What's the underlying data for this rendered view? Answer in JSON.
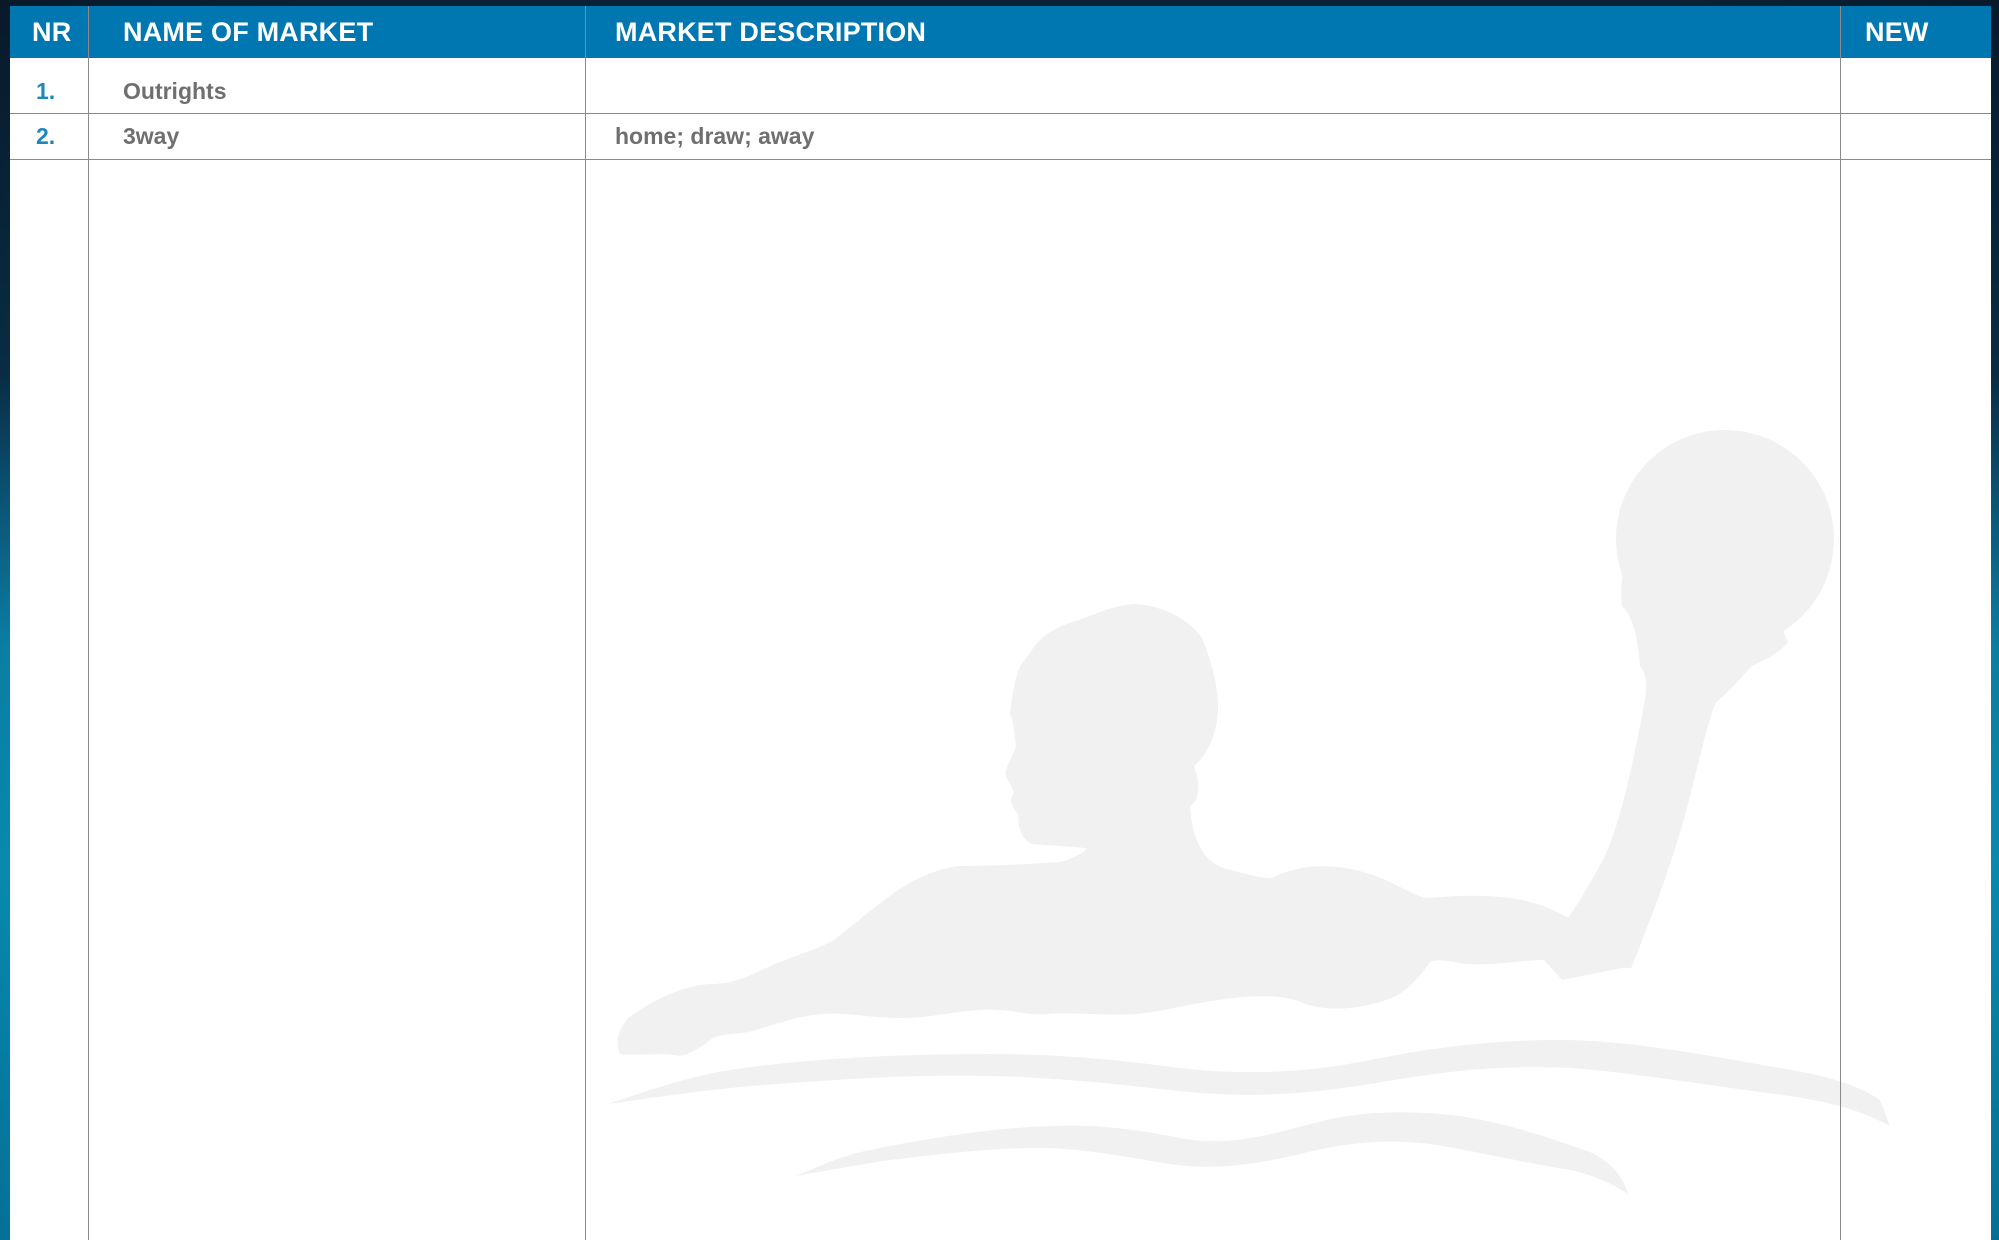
{
  "table": {
    "headers": {
      "nr": "NR",
      "name": "NAME OF MARKET",
      "description": "MARKET DESCRIPTION",
      "new": "NEW"
    },
    "rows": [
      {
        "nr": "1.",
        "name": "Outrights",
        "description": "",
        "new": ""
      },
      {
        "nr": "2.",
        "name": "3way",
        "description": "home; draw; away",
        "new": ""
      }
    ]
  },
  "watermark": {
    "icon": "water-polo-player-silhouette-icon"
  },
  "colors": {
    "header_bg": "#0077b1",
    "header_text": "#ffffff",
    "nr_text": "#1f86bd",
    "cell_text": "#6f6f6f",
    "watermark": "#f1f1f1"
  }
}
